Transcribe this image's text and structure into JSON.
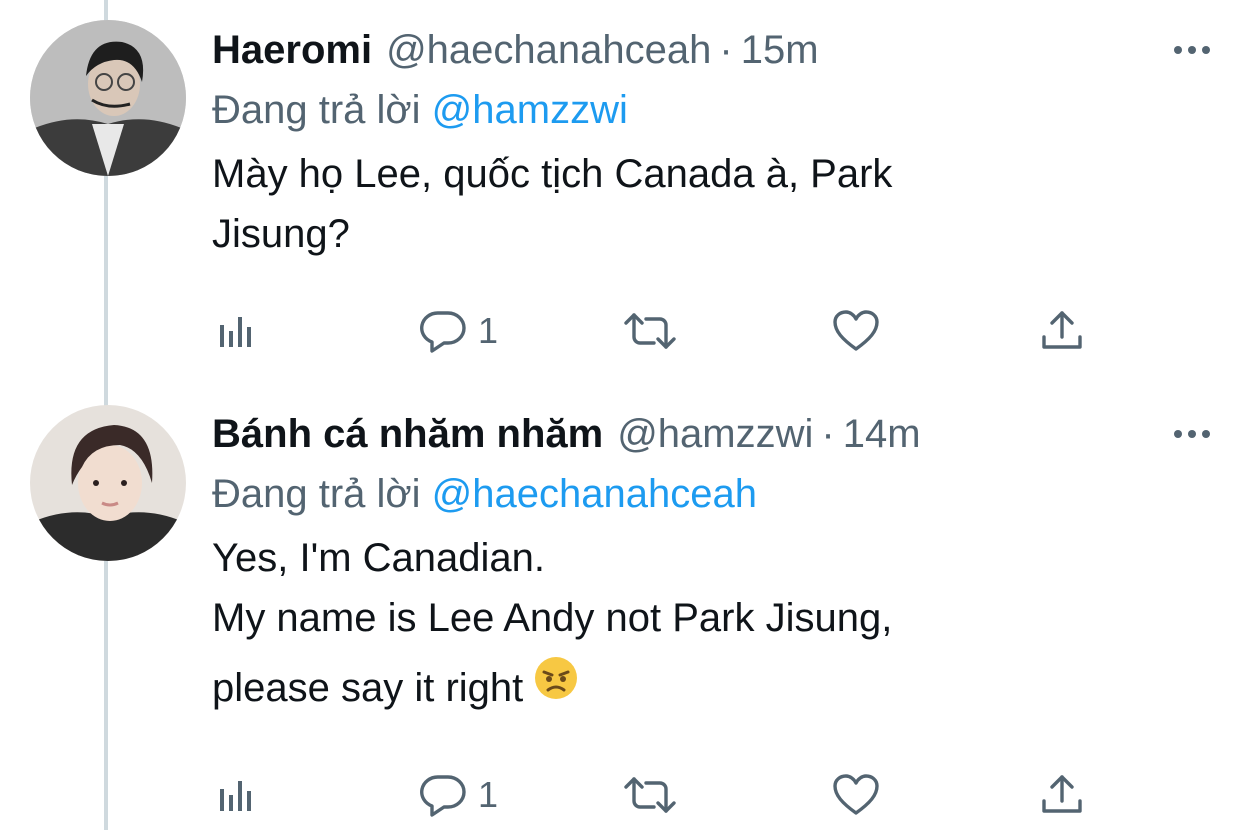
{
  "thread": {
    "reply_prefix": "Đang trả lời"
  },
  "tweets": [
    {
      "name": "Haeromi",
      "handle": "@haechanahceah",
      "separator": "·",
      "time": "15m",
      "reply_to": "@hamzzwi",
      "text_lines": [
        "Mày họ Lee, quốc tịch Canada à, Park",
        "Jisung?"
      ],
      "reply_count": "1",
      "avatar_icon": "profile-photo"
    },
    {
      "name": "Bánh cá nhăm nhăm",
      "handle": "@hamzzwi",
      "separator": "·",
      "time": "14m",
      "reply_to": "@haechanahceah",
      "text_lines": [
        "Yes, I'm Canadian.",
        "My name is Lee Andy not Park Jisung,",
        "please say it right"
      ],
      "reply_count": "1",
      "avatar_icon": "profile-photo"
    }
  ],
  "icons": {
    "more": "more-dots-icon",
    "analytics": "analytics-icon",
    "reply": "reply-bubble-icon",
    "retweet": "retweet-icon",
    "like": "heart-icon",
    "share": "share-icon",
    "emoji": "angry-face-emoji"
  },
  "colors": {
    "text": "#0f1419",
    "secondary": "#536471",
    "link": "#1d9bf0",
    "thread_line": "#cfd9de"
  }
}
